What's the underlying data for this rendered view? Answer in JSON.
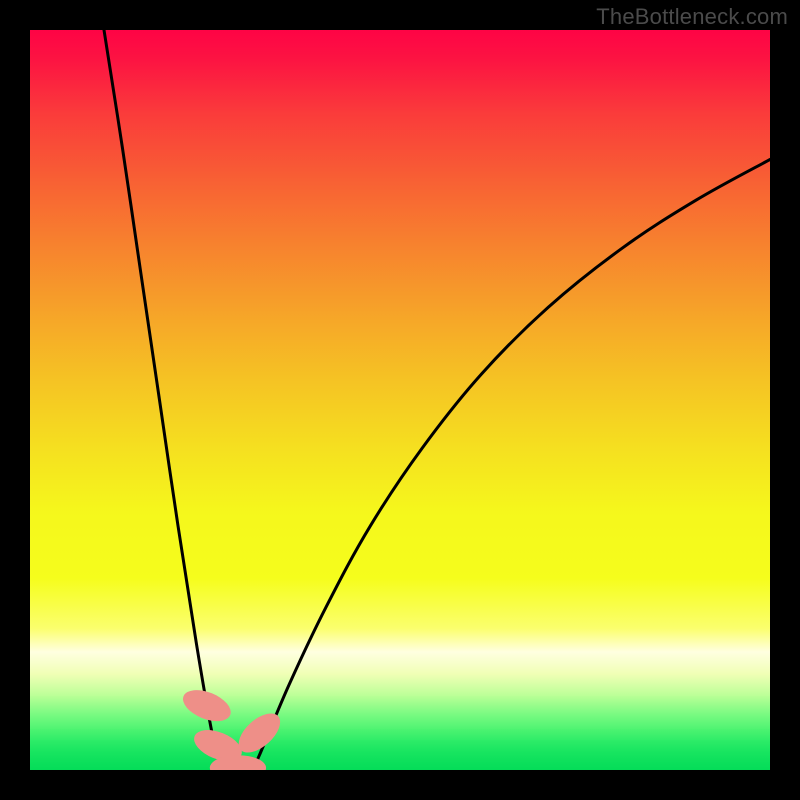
{
  "watermark": "TheBottleneck.com",
  "chart_data": {
    "type": "line",
    "title": "",
    "xlabel": "",
    "ylabel": "",
    "xlim": [
      0,
      100
    ],
    "ylim": [
      0,
      100
    ],
    "grid": false,
    "legend": false,
    "annotations": [],
    "gradient_bands": [
      {
        "y_pct": 100,
        "color": "#fe0345"
      },
      {
        "y_pct": 96,
        "color": "#fc1442"
      },
      {
        "y_pct": 89,
        "color": "#fa3a3b"
      },
      {
        "y_pct": 80,
        "color": "#f85f34"
      },
      {
        "y_pct": 71,
        "color": "#f7822e"
      },
      {
        "y_pct": 62,
        "color": "#f6a329"
      },
      {
        "y_pct": 53,
        "color": "#f5c224"
      },
      {
        "y_pct": 44,
        "color": "#f5de20"
      },
      {
        "y_pct": 35,
        "color": "#f5f71c"
      },
      {
        "y_pct": 26,
        "color": "#f5fd1c"
      },
      {
        "y_pct": 19,
        "color": "#fbff70"
      },
      {
        "y_pct": 16,
        "color": "#ffffe0"
      },
      {
        "y_pct": 13,
        "color": "#f0ffb5"
      },
      {
        "y_pct": 10,
        "color": "#b8ff96"
      },
      {
        "y_pct": 7.5,
        "color": "#77fa81"
      },
      {
        "y_pct": 5.5,
        "color": "#4df371"
      },
      {
        "y_pct": 4,
        "color": "#2eec68"
      },
      {
        "y_pct": 2.5,
        "color": "#18e560"
      },
      {
        "y_pct": 1,
        "color": "#0bdf5b"
      },
      {
        "y_pct": 0,
        "color": "#04dc58"
      }
    ],
    "series": [
      {
        "name": "left-branch",
        "x": [
          10.0,
          12.5,
          15.0,
          17.5,
          20.0,
          22.5,
          24.5,
          25.5,
          26.2
        ],
        "y": [
          100.0,
          84.0,
          67.0,
          50.0,
          33.0,
          17.0,
          5.5,
          1.5,
          0.0
        ],
        "stroke": "#000000",
        "stroke_width": 3
      },
      {
        "name": "valley-floor",
        "x": [
          26.2,
          30.0
        ],
        "y": [
          0.0,
          0.0
        ],
        "stroke": "#000000",
        "stroke_width": 3
      },
      {
        "name": "right-branch",
        "x": [
          30.0,
          31.0,
          35.0,
          40.0,
          46.0,
          53.0,
          61.0,
          70.0,
          80.0,
          90.0,
          100.0
        ],
        "y": [
          0.0,
          2.0,
          11.5,
          22.0,
          33.0,
          43.5,
          53.5,
          62.5,
          70.5,
          77.0,
          82.5
        ],
        "stroke": "#000000",
        "stroke_width": 3
      }
    ],
    "markers": [
      {
        "name": "left-marker-top",
        "x": 23.9,
        "y": 8.7,
        "rx": 1.8,
        "ry": 3.4,
        "angle": -68,
        "color": "#ee8f88"
      },
      {
        "name": "left-marker-bottom",
        "x": 25.4,
        "y": 3.3,
        "rx": 1.8,
        "ry": 3.4,
        "angle": -68,
        "color": "#ee8f88"
      },
      {
        "name": "right-marker",
        "x": 31.0,
        "y": 5.0,
        "rx": 1.8,
        "ry": 3.4,
        "angle": 48,
        "color": "#ee8f88"
      },
      {
        "name": "floor-marker",
        "x": 28.1,
        "y": 0.3,
        "rx": 3.8,
        "ry": 1.7,
        "angle": 0,
        "color": "#ee8f88"
      }
    ]
  }
}
